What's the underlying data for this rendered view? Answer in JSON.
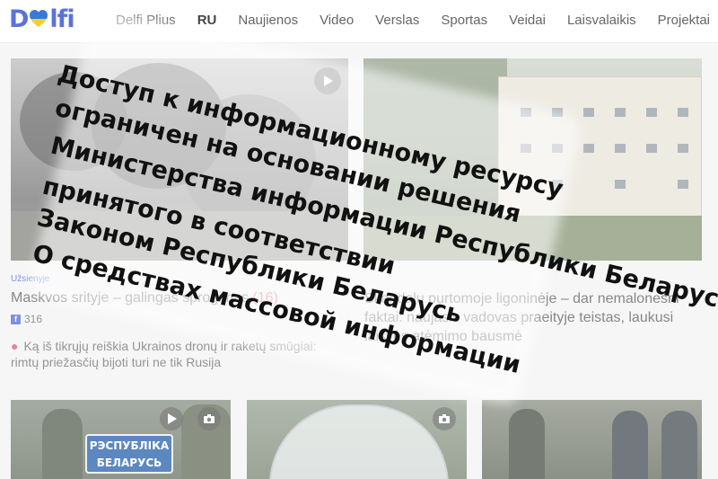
{
  "header": {
    "logo_text_left": "D",
    "logo_text_right": "lfi",
    "nav": [
      "Delfi Plius",
      "RU",
      "Naujienos",
      "Video",
      "Verslas",
      "Sportas",
      "Veidai",
      "Laisvalaikis",
      "Projektai"
    ]
  },
  "colors": {
    "accent": "#5a73d8",
    "counter": "#d8707c",
    "flag_blue": "#3a78d8",
    "flag_yellow": "#f2cf2a"
  },
  "article_main": {
    "category": "Užsienyje",
    "title": "Maskvos srityje – galingas sprogimas",
    "comments": "(16)",
    "facebook_count": "316",
    "related": "Ką iš tikrųjų reiškia Ukrainos dronų ir raketų smūgiai: rimtų priežasčių bijoti turi ne tik Rusija",
    "icons": [
      "play-icon"
    ]
  },
  "article_second": {
    "title": "Skandalų purtomoje ligoninėje – dar nemalonesni faktai: naujasis vadovas praeityje teistas, laukusi laisvės atėmimo bausmė"
  },
  "thumbs": {
    "sign_line1": "РЭСПУБЛІКА",
    "sign_line2": "БЕЛАРУСЬ",
    "icons": [
      "play-icon",
      "camera-icon",
      "camera-icon"
    ]
  },
  "block_message": {
    "lines": [
      "Доступ к информационному ресурсу",
      "ограничен на основании решения",
      "Министерства информации Республики Беларусь,",
      "принятого в соответствии",
      "Законом Республики Беларусь",
      "О средствах массовой информации"
    ]
  }
}
